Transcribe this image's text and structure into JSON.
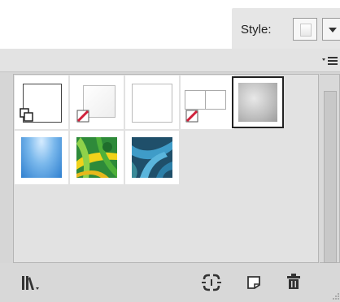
{
  "toolbar": {
    "style_label": "Style:"
  },
  "panel": {
    "menu_icon": "panel-menu-icon",
    "swatches": [
      {
        "name": "default-graphic-style",
        "kind": "default"
      },
      {
        "name": "no-fill-style",
        "kind": "nofill"
      },
      {
        "name": "white-fill-style",
        "kind": "plain"
      },
      {
        "name": "no-fill-split-style",
        "kind": "nofill-split"
      },
      {
        "name": "gray-gradient-style",
        "kind": "gray-gradient",
        "selected": true
      },
      {
        "name": "blue-gradient-style",
        "kind": "blue-gradient"
      },
      {
        "name": "foliage-yellow-style",
        "kind": "foliage-yellow"
      },
      {
        "name": "foliage-blue-style",
        "kind": "foliage-blue"
      }
    ]
  },
  "bottom": {
    "icons": [
      "library-menu-icon",
      "break-link-icon",
      "new-style-icon",
      "trash-icon"
    ]
  },
  "colors": {
    "nofill_red": "#d0203a",
    "selection_border": "#222222"
  }
}
